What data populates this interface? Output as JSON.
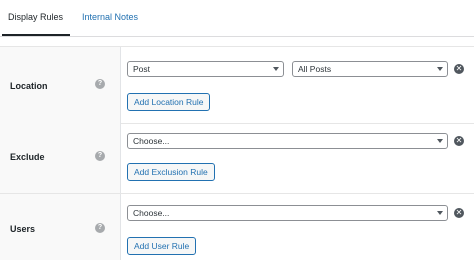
{
  "tabs": [
    {
      "label": "Display Rules"
    },
    {
      "label": "Internal Notes"
    }
  ],
  "rules": {
    "location": {
      "label": "Location",
      "help": "?",
      "select1": "Post",
      "select2": "All Posts",
      "add_button": "Add Location Rule"
    },
    "exclude": {
      "label": "Exclude",
      "help": "?",
      "select": "Choose...",
      "add_button": "Add Exclusion Rule"
    },
    "users": {
      "label": "Users",
      "help": "?",
      "select": "Choose...",
      "add_button": "Add User Rule"
    }
  },
  "icons": {
    "remove": "✕"
  }
}
